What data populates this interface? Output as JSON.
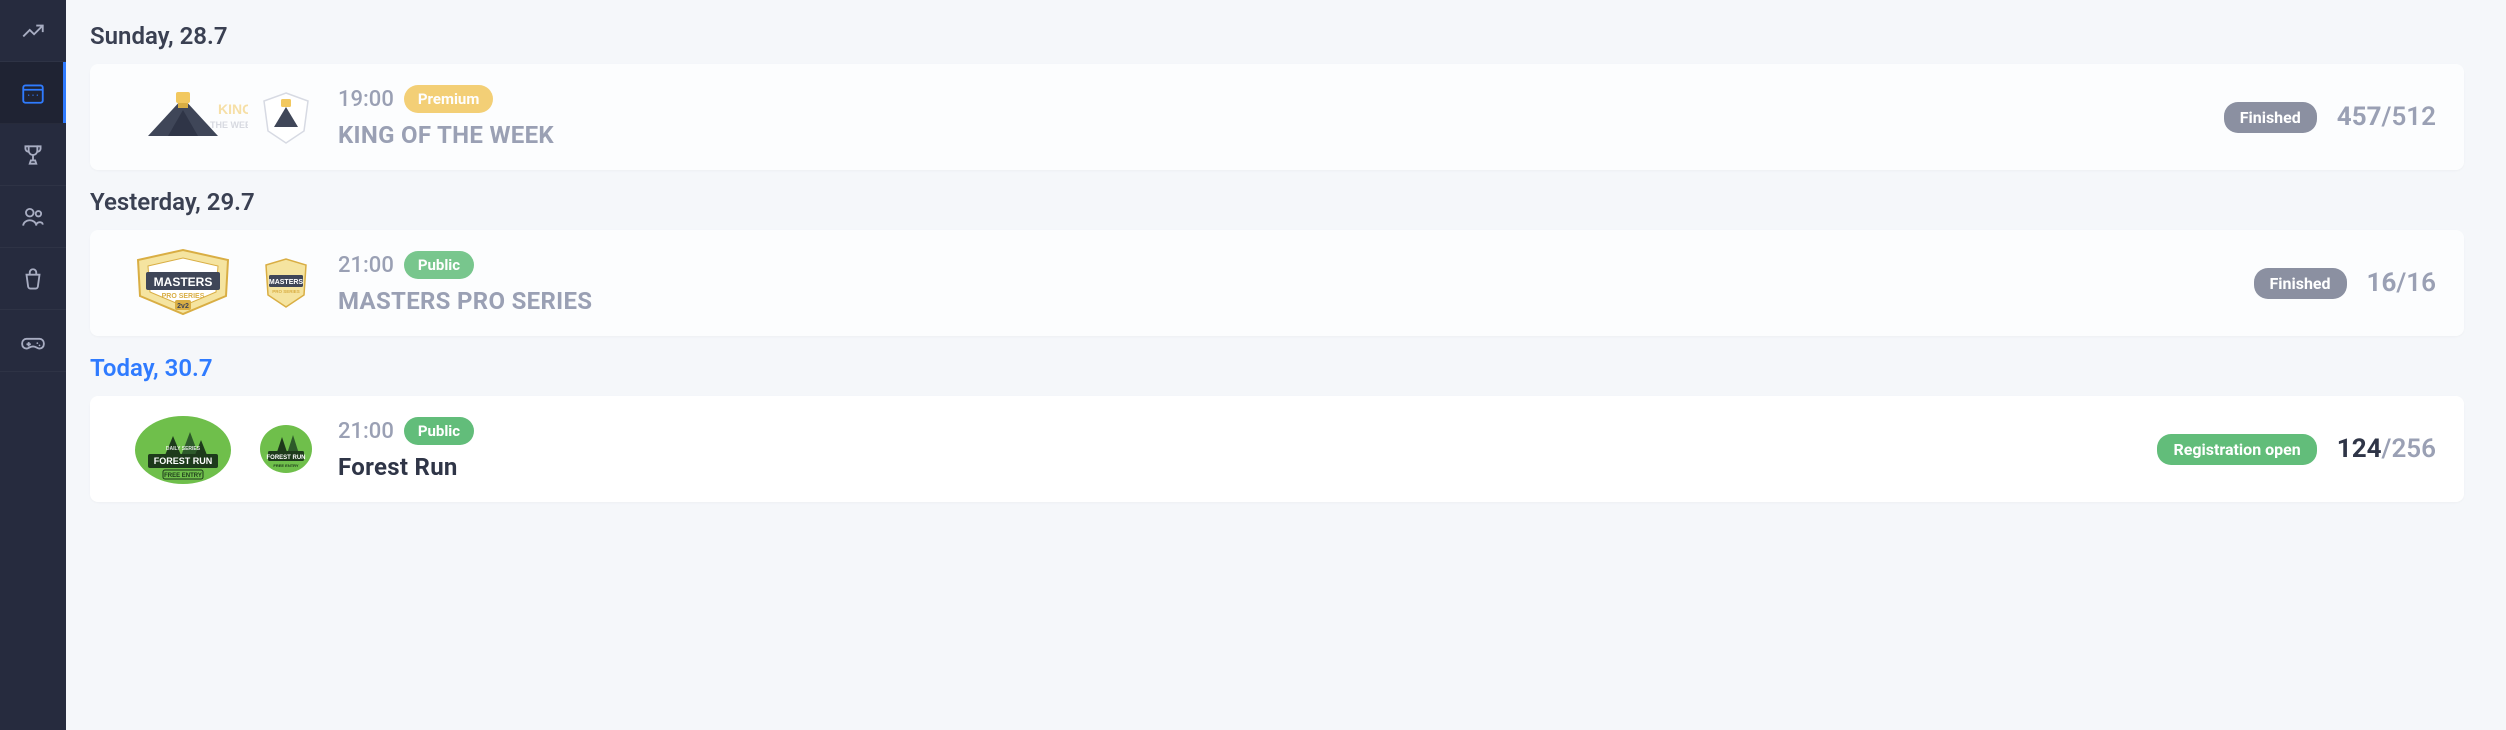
{
  "sidebar": {
    "items": [
      {
        "name": "activity-icon"
      },
      {
        "name": "calendar-icon"
      },
      {
        "name": "trophy-icon"
      },
      {
        "name": "users-icon"
      },
      {
        "name": "shop-icon"
      },
      {
        "name": "game-icon"
      }
    ],
    "active_index": 1
  },
  "days": [
    {
      "heading": "Sunday, 28.7",
      "today": false,
      "events": [
        {
          "time": "19:00",
          "badge_label": "Premium",
          "badge_class": "premium",
          "title": "KING OF THE WEEK",
          "status_label": "Finished",
          "status_class": "finished",
          "count_current": "457",
          "count_max": "512",
          "logo": "king",
          "past": true
        }
      ]
    },
    {
      "heading": "Yesterday, 29.7",
      "today": false,
      "events": [
        {
          "time": "21:00",
          "badge_label": "Public",
          "badge_class": "public",
          "title": "MASTERS PRO SERIES",
          "status_label": "Finished",
          "status_class": "finished",
          "count_current": "16",
          "count_max": "16",
          "logo": "masters",
          "past": true
        }
      ]
    },
    {
      "heading": "Today, 30.7",
      "today": true,
      "events": [
        {
          "time": "21:00",
          "badge_label": "Public",
          "badge_class": "public",
          "title": "Forest Run",
          "status_label": "Registration open",
          "status_class": "open",
          "count_current": "124",
          "count_max": "256",
          "logo": "forest",
          "past": false
        }
      ]
    }
  ]
}
